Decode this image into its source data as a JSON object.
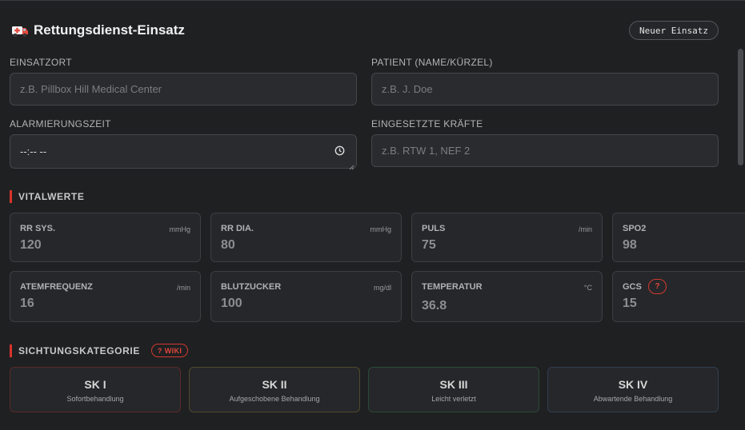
{
  "header": {
    "title": "Rettungsdienst-Einsatz",
    "new_button": "Neuer Einsatz",
    "icon": "ambulance-icon"
  },
  "fields": {
    "einsatzort": {
      "label": "EINSATZORT",
      "placeholder": "z.B. Pillbox Hill Medical Center"
    },
    "patient": {
      "label": "PATIENT (NAME/KÜRZEL)",
      "placeholder": "z.B. J. Doe"
    },
    "alarmierungszeit": {
      "label": "ALARMIERUNGSZEIT",
      "value": "--:-- --"
    },
    "kraefte": {
      "label": "EINGESETZTE KRÄFTE",
      "placeholder": "z.B. RTW 1, NEF 2"
    }
  },
  "vitals": {
    "title": "VITALWERTE",
    "items": [
      {
        "name": "RR SYS.",
        "unit": "mmHg",
        "value": "120"
      },
      {
        "name": "RR DIA.",
        "unit": "mmHg",
        "value": "80"
      },
      {
        "name": "PULS",
        "unit": "/min",
        "value": "75"
      },
      {
        "name": "SPO2",
        "unit": "",
        "value": "98"
      },
      {
        "name": "ATEMFREQUENZ",
        "unit": "/min",
        "value": "16"
      },
      {
        "name": "BLUTZUCKER",
        "unit": "mg/dl",
        "value": "100"
      },
      {
        "name": "TEMPERATUR",
        "unit": "°C",
        "value": "36.8"
      },
      {
        "name": "GCS",
        "unit": "",
        "value": "15",
        "help": "?"
      }
    ]
  },
  "triage": {
    "title": "SICHTUNGSKATEGORIE",
    "wiki": "? WIKI",
    "categories": [
      {
        "title": "SK I",
        "subtitle": "Sofortbehandlung",
        "color": "#5a2a2a"
      },
      {
        "title": "SK II",
        "subtitle": "Aufgeschobene Behandlung",
        "color": "#4f4a2a"
      },
      {
        "title": "SK III",
        "subtitle": "Leicht verletzt",
        "color": "#2a4a38"
      },
      {
        "title": "SK IV",
        "subtitle": "Abwartende Behandlung",
        "color": "#2f3f52"
      }
    ]
  },
  "colors": {
    "accent": "#d9342b"
  }
}
